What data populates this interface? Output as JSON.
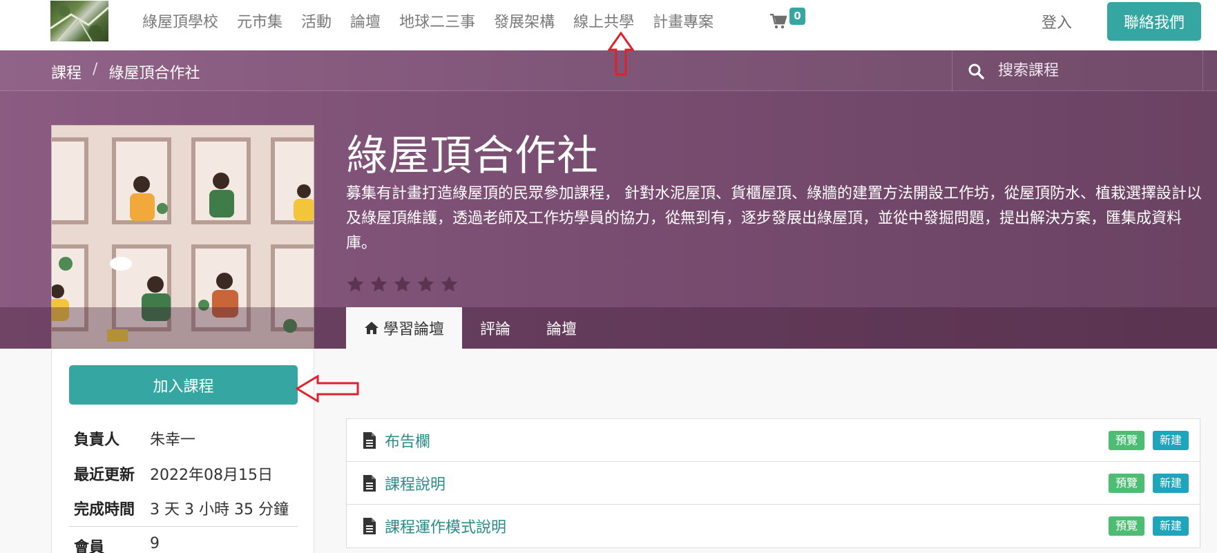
{
  "nav": {
    "items": [
      "綠屋頂學校",
      "元市集",
      "活動",
      "論壇",
      "地球二三事",
      "發展架構",
      "線上共學",
      "計畫專案"
    ],
    "cart_count": "0",
    "login": "登入",
    "contact": "聯絡我們"
  },
  "breadcrumb": {
    "root": "課程",
    "separator": "/",
    "current": "綠屋頂合作社"
  },
  "search": {
    "placeholder": "搜索課程"
  },
  "course": {
    "title": "綠屋頂合作社",
    "description": "募集有計畫打造綠屋頂的民眾參加課程， 針對水泥屋頂、貨櫃屋頂、綠牆的建置方法開設工作坊，從屋頂防水、植栽選擇設計以及綠屋頂維護，透過老師及工作坊學員的協力，從無到有，逐步發展出綠屋頂，並從中發掘問題，提出解決方案，匯集成資料庫。",
    "rating": 0
  },
  "tabs": [
    "學習論壇",
    "評論",
    "論壇"
  ],
  "sidebar": {
    "join": "加入課程",
    "rows": [
      {
        "k": "負責人",
        "v": "朱幸一"
      },
      {
        "k": "最近更新",
        "v": "2022年08月15日"
      },
      {
        "k": "完成時間",
        "v": "3 天 3 小時 35 分鐘"
      },
      {
        "k": "會員",
        "v": "9"
      }
    ]
  },
  "contents": [
    {
      "title": "布告欄",
      "preview": "預覽",
      "new": "新建"
    },
    {
      "title": "課程說明",
      "preview": "預覽",
      "new": "新建"
    },
    {
      "title": "課程運作模式說明",
      "preview": "預覽",
      "new": "新建"
    }
  ],
  "colors": {
    "accent": "#35a6a1",
    "banner": "#7a4e72",
    "preview_badge": "#4dbd74",
    "new_badge": "#1ea4bb",
    "annotation": "#e0202a"
  }
}
